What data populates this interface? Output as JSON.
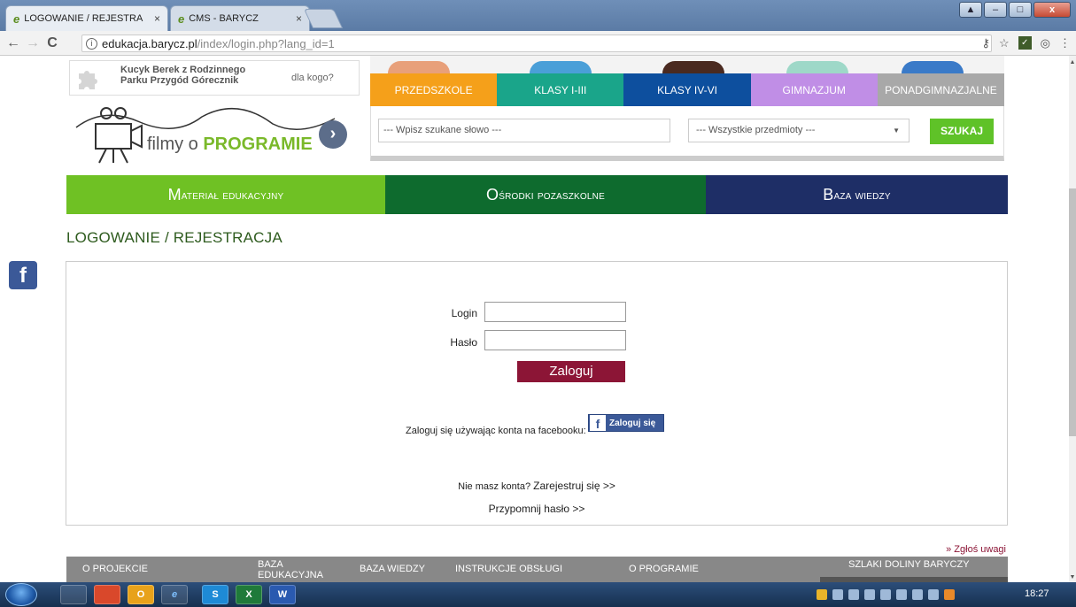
{
  "browser": {
    "tabs": [
      {
        "logo": "e",
        "title": "LOGOWANIE / REJESTRA",
        "close": "×"
      },
      {
        "logo": "e",
        "title": "CMS - BARYCZ",
        "close": "×"
      }
    ],
    "url_host": "edukacja.barycz.pl",
    "url_path": "/index/login.php?lang_id=1",
    "nav_back": "←",
    "nav_forward": "→",
    "nav_reload": "C",
    "bookmark_star": "☆"
  },
  "header": {
    "promo_title": "Kucyk Berek z Rodzinnego Parku Przygód Górecznik",
    "promo_link": "dla kogo?",
    "films_prefix": "filmy o ",
    "films_highlight": "PROGRAMIE",
    "films_arrow": "›",
    "level_tabs": [
      {
        "label": "PRZEDSZKOLE",
        "color": "#f5a01a"
      },
      {
        "label": "KLASY I-III",
        "color": "#1aa58a"
      },
      {
        "label": "KLASY IV-VI",
        "color": "#0d4f9e"
      },
      {
        "label": "GIMNAZJUM",
        "color": "#c08ee6"
      },
      {
        "label": "PONADGIMNAZJALNE",
        "color": "#a8a8a8"
      }
    ],
    "search_placeholder": "--- Wpisz szukane słowo ---",
    "subject_select": "--- Wszystkie przedmioty ---",
    "search_button": "SZUKAJ"
  },
  "main_nav": [
    {
      "first": "M",
      "rest": "ateriał edukacyjny",
      "color": "#6fc124"
    },
    {
      "first": "O",
      "rest": "środki pozaszkolne",
      "color": "#0e6b2e"
    },
    {
      "first": "B",
      "rest": "aza wiedzy",
      "color": "#1e2e66"
    }
  ],
  "page_title": "LOGOWANIE / REJESTRACJA",
  "login": {
    "login_label": "Login",
    "password_label": "Hasło",
    "submit_label": "Zaloguj",
    "fb_text": "Zaloguj się używając konta na facebooku:",
    "fb_button": "Zaloguj się",
    "register_prefix": "Nie masz konta?",
    "register_link": "Zarejestruj się >>",
    "remind_link": "Przypomnij hasło >>"
  },
  "report_link": "» Zgłoś uwagi",
  "footer": [
    "O PROJEKCIE",
    "BAZA EDUKACYJNA",
    "BAZA WIEDZY",
    "INSTRUKCJE OBSŁUGI",
    "O PROGRAMIE",
    "SZLAKI DOLINY BARYCZY"
  ],
  "taskbar": {
    "clock": "18:27",
    "apps": [
      "",
      "",
      "O",
      "e",
      "S",
      "X",
      "W"
    ]
  },
  "colors": {
    "brand_green": "#6fc124",
    "login_button": "#8c1536",
    "facebook": "#3b5998"
  }
}
